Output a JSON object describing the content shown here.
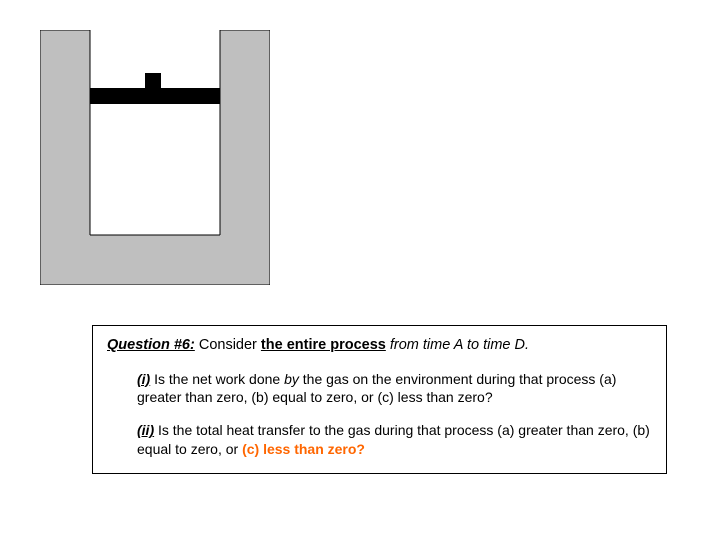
{
  "question": {
    "label": "Question #6:",
    "lead": " Consider ",
    "process": "the entire process",
    "tail": " from time A to time D."
  },
  "part_i": {
    "label": "(i)",
    "text_a": " Is the net work done ",
    "by": "by",
    "text_b": " the gas on the environment during that process (a) greater than zero, (b) equal to zero, or (c) less than zero?"
  },
  "part_ii": {
    "label": "(ii)",
    "text_a": " Is the total heat transfer to the gas during that process (a) greater than zero, (b) equal to zero, or ",
    "highlight": "(c) less than zero?"
  }
}
